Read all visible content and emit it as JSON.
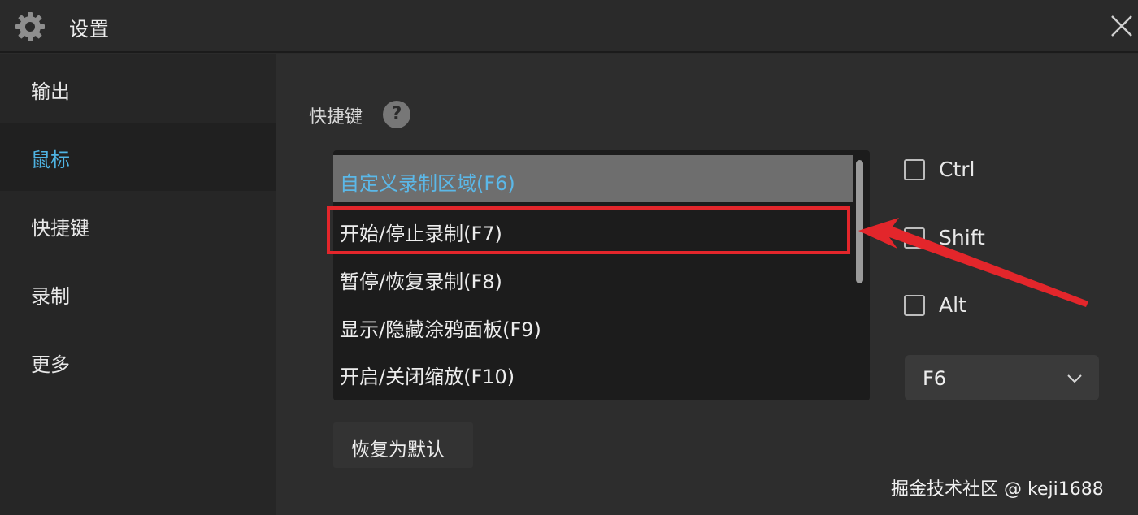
{
  "window": {
    "title": "设置",
    "icon": "gear-icon",
    "close_icon": "close-icon"
  },
  "sidebar": {
    "items": [
      {
        "label": "输出",
        "active": false
      },
      {
        "label": "鼠标",
        "active": true
      },
      {
        "label": "快捷键",
        "active": false
      },
      {
        "label": "录制",
        "active": false
      },
      {
        "label": "更多",
        "active": false
      }
    ]
  },
  "main": {
    "section_title": "快捷键",
    "help_icon": "question-icon",
    "help_glyph": "?",
    "actions": [
      {
        "label": "自定义录制区域(F6)",
        "selected": true
      },
      {
        "label": "开始/停止录制(F7)",
        "selected": false,
        "highlighted": true
      },
      {
        "label": "暂停/恢复录制(F8)",
        "selected": false
      },
      {
        "label": "显示/隐藏涂鸦面板(F9)",
        "selected": false
      },
      {
        "label": "开启/关闭缩放(F10)",
        "selected": false
      }
    ],
    "modifiers": [
      {
        "label": "Ctrl",
        "checked": false
      },
      {
        "label": "Shift",
        "checked": false
      },
      {
        "label": "Alt",
        "checked": false
      }
    ],
    "key_select": {
      "value": "F6"
    },
    "reset_button": "恢复为默认"
  },
  "annotation": {
    "highlight_color": "#e3262b",
    "arrow_color": "#e3262b"
  },
  "watermark": "掘金技术社区 @ keji1688",
  "colors": {
    "accent": "#4fb4e3",
    "selected_bg": "#6e6e6e",
    "background": "#2d2d2d"
  }
}
